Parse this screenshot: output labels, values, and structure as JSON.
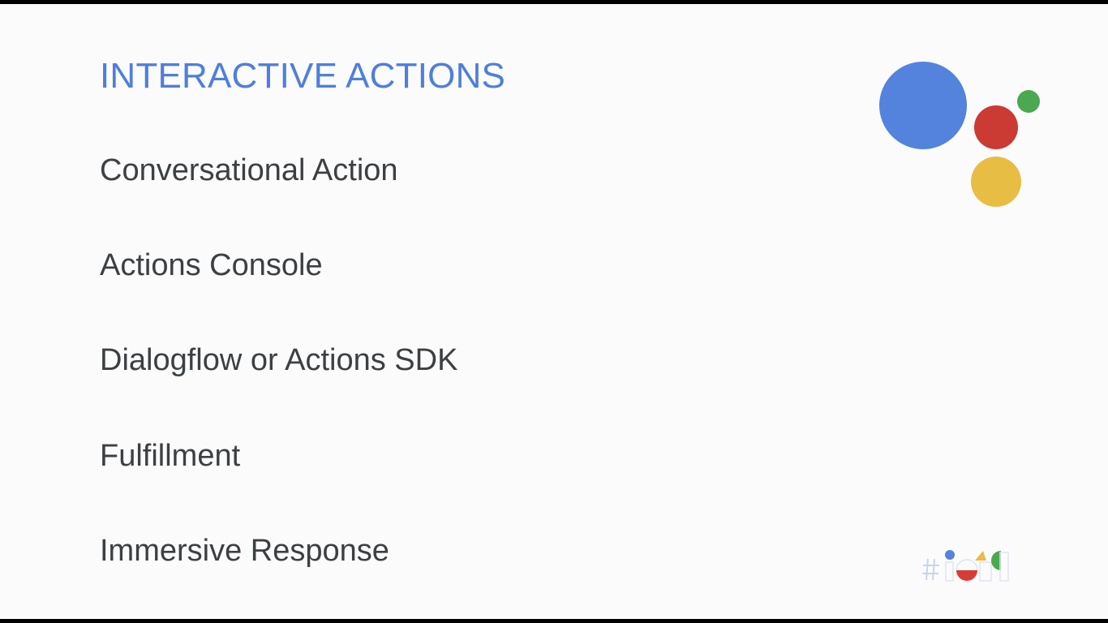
{
  "slide": {
    "title": "INTERACTIVE ACTIONS",
    "items": [
      "Conversational Action",
      "Actions Console",
      "Dialogflow or Actions SDK",
      "Fulfillment",
      "Immersive Response"
    ]
  },
  "colors": {
    "title": "#4e7fdc",
    "body_text": "#3c4043",
    "background": "#fbfbfb",
    "frame": "#000000",
    "logo_blue": "#5383dd",
    "logo_red": "#cb3a33",
    "logo_yellow": "#e8bd44",
    "logo_green": "#4ca751"
  },
  "logos": {
    "assistant": "google-assistant-icon",
    "io": "google-io-icon"
  }
}
